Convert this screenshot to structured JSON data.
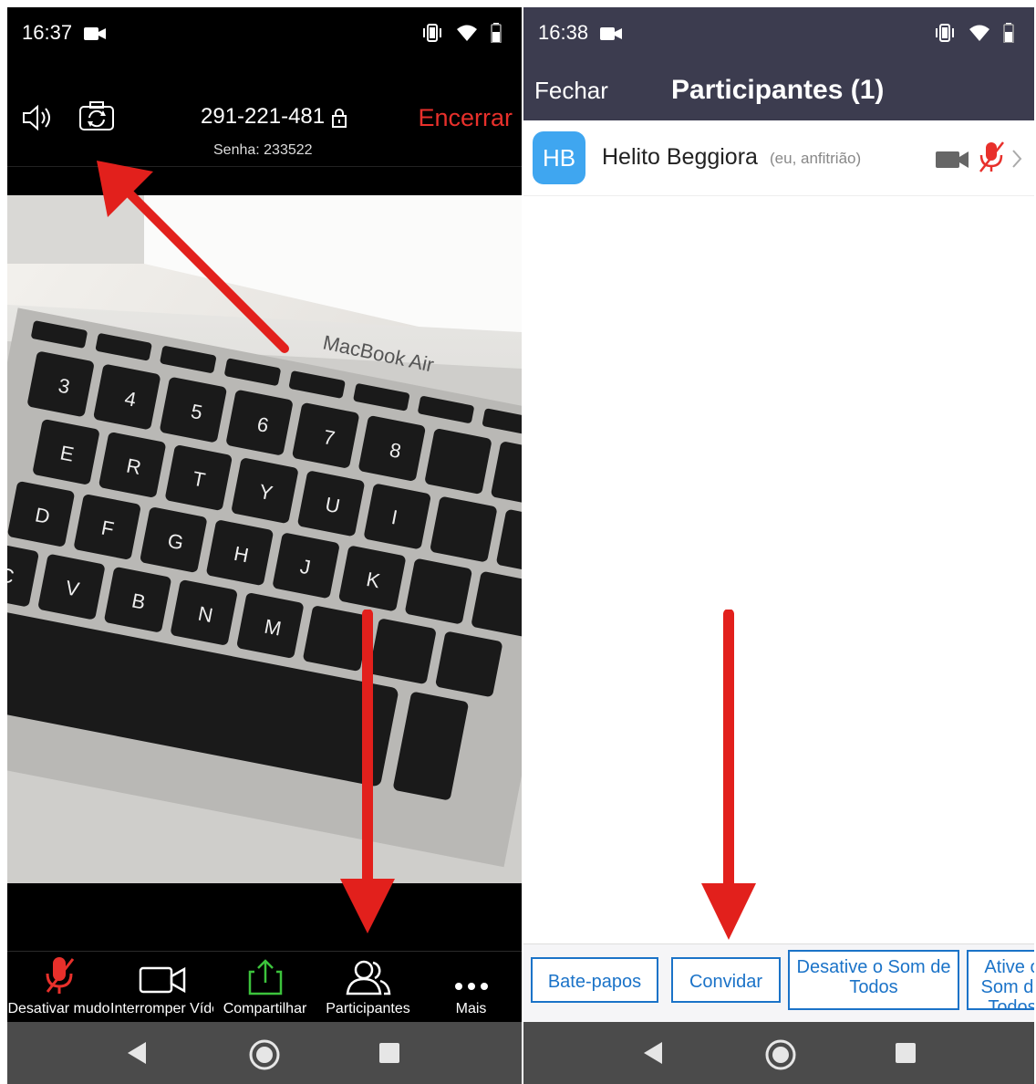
{
  "left": {
    "status": {
      "time": "16:37"
    },
    "meeting": {
      "meeting_id": "291-221-481",
      "password": "Senha: 233522",
      "end_label": "Encerrar"
    },
    "feed": {
      "laptop_text": "MacBook Air"
    },
    "toolbar": [
      {
        "label": "Desativar mudo",
        "icon": "muted-mic-icon"
      },
      {
        "label": "Interromper Vídeo",
        "icon": "video-camera-icon"
      },
      {
        "label": "Compartilhar",
        "icon": "share-upload-icon"
      },
      {
        "label": "Participantes",
        "icon": "participants-icon"
      },
      {
        "label": "Mais",
        "icon": "more-dots-icon"
      }
    ]
  },
  "right": {
    "status": {
      "time": "16:38"
    },
    "header": {
      "close_label": "Fechar",
      "title": "Participantes (1)"
    },
    "participant": {
      "initials": "HB",
      "name": "Helito Beggiora",
      "role": "(eu, anfitrião)"
    },
    "actions": [
      {
        "label": "Bate-papos"
      },
      {
        "label": "Convidar"
      },
      {
        "label": "Desative o Som de Todos"
      },
      {
        "label": "Ative o Som de Todos"
      }
    ]
  },
  "colors": {
    "accent_red": "#e8302b",
    "zoom_blue": "#1b73c8",
    "header_bg": "#3c3c4f",
    "avatar_bg": "#3fa6f0",
    "share_green": "#3cc33c"
  }
}
